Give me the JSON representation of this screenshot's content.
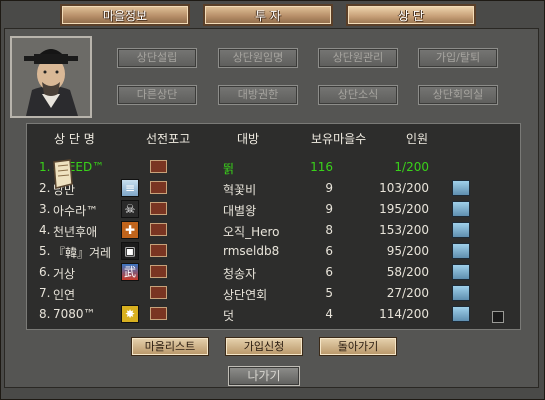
{
  "tabs": [
    {
      "label": "마을정보",
      "active": false
    },
    {
      "label": "투  자",
      "active": false
    },
    {
      "label": "상  단",
      "active": true
    }
  ],
  "actions_row1": [
    "상단설립",
    "상단원임명",
    "상단원관리",
    "가입/탈퇴"
  ],
  "actions_row2": [
    "다른상단",
    "대방권한",
    "상단소식",
    "상단회의실"
  ],
  "columns": {
    "name": "상 단 명",
    "war": "선전포고",
    "boss": "대방",
    "villages": "보유마을수",
    "members": "인원"
  },
  "rows": [
    {
      "rank": "1.",
      "name": "SPEED™",
      "emblem": "",
      "boss": "뛹",
      "villages": "116",
      "members": "1/200",
      "highlight": true,
      "book": false
    },
    {
      "rank": "2.",
      "name": "낭만",
      "emblem": "scroll",
      "boss": "혁꽃비",
      "villages": "9",
      "members": "103/200",
      "highlight": false,
      "book": true
    },
    {
      "rank": "3.",
      "name": "아수라™",
      "emblem": "skull",
      "boss": "대별왕",
      "villages": "9",
      "members": "195/200",
      "highlight": false,
      "book": true
    },
    {
      "rank": "4.",
      "name": "천년후애",
      "emblem": "cross",
      "boss": "오직_Hero",
      "villages": "8",
      "members": "153/200",
      "highlight": false,
      "book": true
    },
    {
      "rank": "5.",
      "name": "『韓』겨레",
      "emblem": "seal",
      "boss": "rmseldb8",
      "villages": "6",
      "members": "95/200",
      "highlight": false,
      "book": true
    },
    {
      "rank": "6.",
      "name": "거상",
      "emblem": "martial",
      "boss": "청송자",
      "villages": "6",
      "members": "58/200",
      "highlight": false,
      "book": true
    },
    {
      "rank": "7.",
      "name": "인연",
      "emblem": "",
      "boss": "상단연회",
      "villages": "5",
      "members": "27/200",
      "highlight": false,
      "book": true
    },
    {
      "rank": "8.",
      "name": "7080™",
      "emblem": "gold",
      "boss": "덧",
      "villages": "4",
      "members": "114/200",
      "highlight": false,
      "book": true
    }
  ],
  "footer_buttons": [
    "마을리스트",
    "가입신청",
    "돌아가기"
  ],
  "exit_label": "나가기",
  "colors": {
    "highlight": "#39d21a",
    "text": "#e8e4da",
    "panel": "#555553"
  }
}
